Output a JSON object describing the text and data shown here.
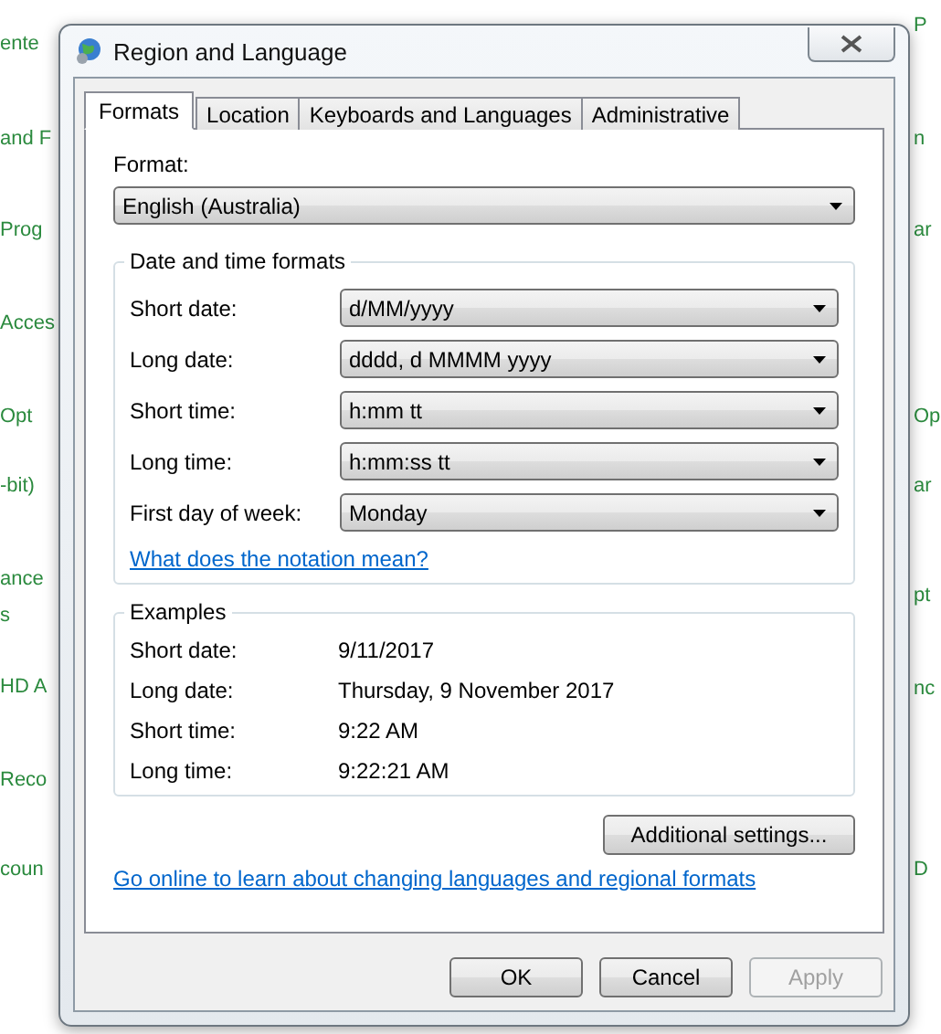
{
  "background": {
    "left_fragments": [
      "ente",
      "and F",
      "Prog",
      "Acces",
      "Opt",
      "-bit)",
      "ance",
      "s",
      "HD A",
      "Reco",
      "coun"
    ],
    "right_fragments": [
      "P",
      "n",
      "ar",
      "Op",
      "ar",
      "pt",
      "nc",
      "D"
    ]
  },
  "window": {
    "title": "Region and Language"
  },
  "tabs": [
    {
      "label": "Formats",
      "selected": true
    },
    {
      "label": "Location",
      "selected": false
    },
    {
      "label": "Keyboards and Languages",
      "selected": false
    },
    {
      "label": "Administrative",
      "selected": false
    }
  ],
  "format": {
    "label": "Format:",
    "value": "English (Australia)"
  },
  "date_time_formats": {
    "title": "Date and time formats",
    "rows": [
      {
        "label": "Short date:",
        "value": "d/MM/yyyy"
      },
      {
        "label": "Long date:",
        "value": "dddd, d MMMM yyyy"
      },
      {
        "label": "Short time:",
        "value": "h:mm tt"
      },
      {
        "label": "Long time:",
        "value": "h:mm:ss tt"
      },
      {
        "label": "First day of week:",
        "value": "Monday"
      }
    ],
    "link": "What does the notation mean?"
  },
  "examples": {
    "title": "Examples",
    "rows": [
      {
        "label": "Short date:",
        "value": "9/11/2017"
      },
      {
        "label": "Long date:",
        "value": "Thursday, 9 November 2017"
      },
      {
        "label": "Short time:",
        "value": "9:22 AM"
      },
      {
        "label": "Long time:",
        "value": "9:22:21 AM"
      }
    ]
  },
  "additional_settings_button": "Additional settings...",
  "online_link": "Go online to learn about changing languages and regional formats",
  "buttons": [
    {
      "label": "OK",
      "disabled": false
    },
    {
      "label": "Cancel",
      "disabled": false
    },
    {
      "label": "Apply",
      "disabled": true
    }
  ]
}
